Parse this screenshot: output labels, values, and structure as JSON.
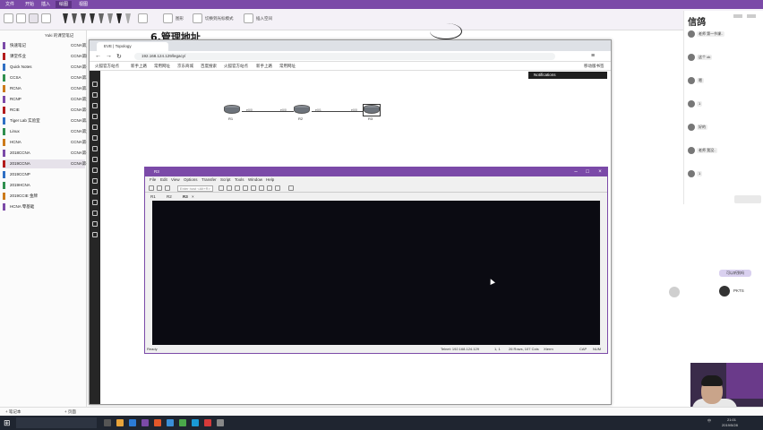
{
  "app": {
    "menu_tabs": [
      "文件",
      "开始",
      "插入",
      "绘图",
      "视图"
    ],
    "tool_labels": [
      "选择",
      "套索",
      "套索选择",
      "擦除"
    ],
    "toolbar_extra": [
      "图形",
      "切换到光标模式",
      "插入空间"
    ]
  },
  "notebook": {
    "header": "Yuki 的课堂笔记",
    "items": [
      {
        "left": "快速笔记",
        "right": "CCNA第五..",
        "color": "#7b4aa8"
      },
      {
        "left": "课堂作业",
        "right": "CCNA第四..",
        "color": "#b31b1b"
      },
      {
        "left": "Quick Notes",
        "right": "CCNA第一..",
        "color": "#2f6fc4"
      },
      {
        "left": "CCSA",
        "right": "CCNA第三..",
        "color": "#2f8f4e"
      },
      {
        "left": "RCNA",
        "right": "CCNA第二..",
        "color": "#cc7a1a"
      },
      {
        "left": "RCNP",
        "right": "CCNA第六..",
        "color": "#7b4aa8"
      },
      {
        "left": "RCIE",
        "right": "CCNA第七..",
        "color": "#b31b1b"
      },
      {
        "left": "Tiger Lab 实验室",
        "right": "CCNA第八..",
        "color": "#2f6fc4"
      },
      {
        "left": "Linux",
        "right": "CCNA第九..",
        "color": "#2f8f4e"
      },
      {
        "left": "HCNA",
        "right": "CCNA第十..",
        "color": "#cc7a1a"
      },
      {
        "left": "2018CCNA",
        "right": "CCNA第十..",
        "color": "#7b4aa8"
      },
      {
        "left": "2019CCNA",
        "right": "CCNA第十..",
        "color": "#b31b1b",
        "selected": true
      },
      {
        "left": "2019CCNP",
        "right": "",
        "color": "#2f6fc4"
      },
      {
        "left": "2019HCNA",
        "right": "",
        "color": "#2f8f4e"
      },
      {
        "left": "2019CCIE 金牌",
        "right": "",
        "color": "#cc7a1a"
      },
      {
        "left": "HCNA 零基础",
        "right": "",
        "color": "#7b4aa8"
      }
    ],
    "add_notebook": "+ 笔记本",
    "add_page": "+ 页面"
  },
  "page": {
    "handwritten_title": "6.管理地址"
  },
  "browser": {
    "tab_title": "EVE | Topology",
    "address": "192.168.124.129/legacy/",
    "bookmarks": [
      "火狐官方站点",
      "新手上路",
      "常用网址",
      "京东商城",
      "百度搜索",
      "火狐官方站点",
      "新手上路",
      "常用网址"
    ],
    "bookmarks_right": "移动版书签",
    "notifications": "Notifications",
    "routers": [
      {
        "name": "R1"
      },
      {
        "name": "R2"
      },
      {
        "name": "R3"
      }
    ],
    "ports": [
      "e0/0",
      "e0/0",
      "e0/1",
      "e0/0"
    ]
  },
  "crt": {
    "title": "R3",
    "menu": [
      "File",
      "Edit",
      "View",
      "Options",
      "Transfer",
      "Script",
      "Tools",
      "Window",
      "Help"
    ],
    "host_placeholder": "Enter host <Alt+R>",
    "tabs": [
      "R1",
      "R2",
      "R3"
    ],
    "status": {
      "ready": "Ready",
      "telnet": "Telnet: 192.168.124.129",
      "pos": "1, 1",
      "size": "26 Rows, 107 Cols",
      "term": "Xterm",
      "caps": "CAP",
      "num": "NUM"
    }
  },
  "chat": {
    "title": "信鸽",
    "messages": [
      {
        "text": "老师 第一节课..",
        "time": ""
      },
      {
        "text": "这个 ok",
        "time": ""
      },
      {
        "text": "嗯",
        "time": ""
      },
      {
        "text": "1",
        "time": ""
      },
      {
        "text": "好的",
        "time": ""
      },
      {
        "text": "老师 我没..",
        "time": ""
      },
      {
        "text": "1",
        "time": ""
      }
    ],
    "floating": "可以听到吗",
    "floating_user": "PKTS"
  },
  "taskbar": {
    "time": "21:01",
    "date": "2019/5/28",
    "lang": "中"
  }
}
